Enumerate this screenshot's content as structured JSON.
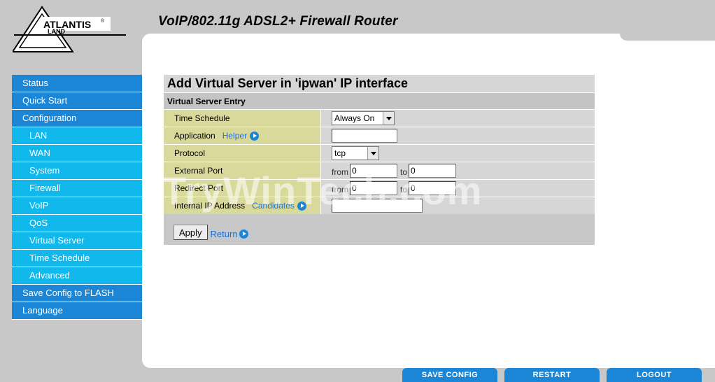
{
  "header": {
    "logo_text": "ATLANTIS LAND",
    "title": "VoIP/802.11g ADSL2+ Firewall Router"
  },
  "sidebar": {
    "items": [
      {
        "label": "Status",
        "level": "main"
      },
      {
        "label": "Quick Start",
        "level": "main"
      },
      {
        "label": "Configuration",
        "level": "main"
      },
      {
        "label": "LAN",
        "level": "sub"
      },
      {
        "label": "WAN",
        "level": "sub"
      },
      {
        "label": "System",
        "level": "sub"
      },
      {
        "label": "Firewall",
        "level": "sub"
      },
      {
        "label": "VoIP",
        "level": "sub"
      },
      {
        "label": "QoS",
        "level": "sub"
      },
      {
        "label": "Virtual Server",
        "level": "sub"
      },
      {
        "label": "Time Schedule",
        "level": "sub"
      },
      {
        "label": "Advanced",
        "level": "sub"
      },
      {
        "label": "Save Config to FLASH",
        "level": "main"
      },
      {
        "label": "Language",
        "level": "main"
      }
    ]
  },
  "form": {
    "title": "Add Virtual Server in 'ipwan' IP interface",
    "section": "Virtual Server Entry",
    "time_schedule": {
      "label": "Time Schedule",
      "value": "Always On"
    },
    "application": {
      "label": "Application",
      "helper": "Helper",
      "value": ""
    },
    "protocol": {
      "label": "Protocol",
      "value": "tcp"
    },
    "external_port": {
      "label": "External Port",
      "from_label": "from",
      "from_value": "0",
      "to_label": "to",
      "to_value": "0"
    },
    "redirect_port": {
      "label": "Redirect Port",
      "from_label": "from",
      "from_value": "0",
      "to_label": "to",
      "to_value": "0"
    },
    "internal_ip": {
      "label": "Internal IP Address",
      "candidates": "Candidates",
      "value": ""
    },
    "apply_label": "Apply",
    "return_label": "Return"
  },
  "watermark": "TryWinTech.com",
  "bottom": {
    "save_config": "SAVE CONFIG",
    "restart": "RESTART",
    "logout": "LOGOUT"
  },
  "colors": {
    "nav_main": "#1c86d6",
    "nav_sub": "#11b8ec",
    "label_cell": "#d9d99b",
    "link": "#1c6fd6"
  }
}
